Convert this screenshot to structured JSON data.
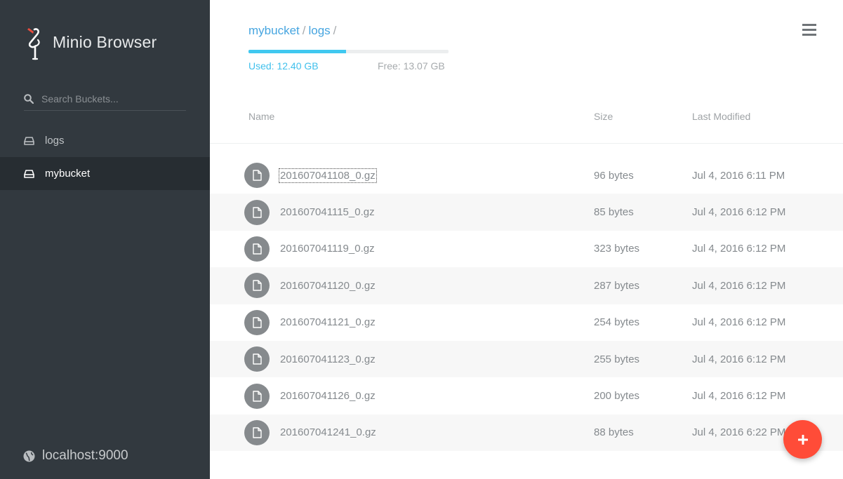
{
  "app": {
    "title": "Minio Browser"
  },
  "sidebar": {
    "search_placeholder": "Search Buckets...",
    "buckets": [
      {
        "label": "logs",
        "active": false
      },
      {
        "label": "mybucket",
        "active": true
      }
    ],
    "host": "localhost:9000"
  },
  "breadcrumb": {
    "bucket": "mybucket",
    "folder": "logs",
    "separator": "/"
  },
  "storage": {
    "used": "Used: 12.40 GB",
    "free": "Free: 13.07 GB",
    "used_fraction": 0.487
  },
  "table": {
    "columns": {
      "name": "Name",
      "size": "Size",
      "modified": "Last Modified"
    },
    "rows": [
      {
        "name": "201607041108_0.gz",
        "size": "96 bytes",
        "modified": "Jul 4, 2016 6:11 PM"
      },
      {
        "name": "201607041115_0.gz",
        "size": "85 bytes",
        "modified": "Jul 4, 2016 6:12 PM"
      },
      {
        "name": "201607041119_0.gz",
        "size": "323 bytes",
        "modified": "Jul 4, 2016 6:12 PM"
      },
      {
        "name": "201607041120_0.gz",
        "size": "287 bytes",
        "modified": "Jul 4, 2016 6:12 PM"
      },
      {
        "name": "201607041121_0.gz",
        "size": "254 bytes",
        "modified": "Jul 4, 2016 6:12 PM"
      },
      {
        "name": "201607041123_0.gz",
        "size": "255 bytes",
        "modified": "Jul 4, 2016 6:12 PM"
      },
      {
        "name": "201607041126_0.gz",
        "size": "200 bytes",
        "modified": "Jul 4, 2016 6:12 PM"
      },
      {
        "name": "201607041241_0.gz",
        "size": "88 bytes",
        "modified": "Jul 4, 2016 6:22 PM"
      }
    ]
  },
  "icons": {
    "logo": "minio-crane-logo-icon",
    "search": "search-icon",
    "bucket": "hard-drive-icon",
    "host": "globe-icon",
    "menu": "hamburger-menu-icon",
    "file": "file-icon",
    "fab": "plus-icon"
  },
  "colors": {
    "sidebar": "#32393f",
    "accent": "#46a5e0",
    "usage_bar": "#40c8f0",
    "fab": "#ff4c38"
  }
}
